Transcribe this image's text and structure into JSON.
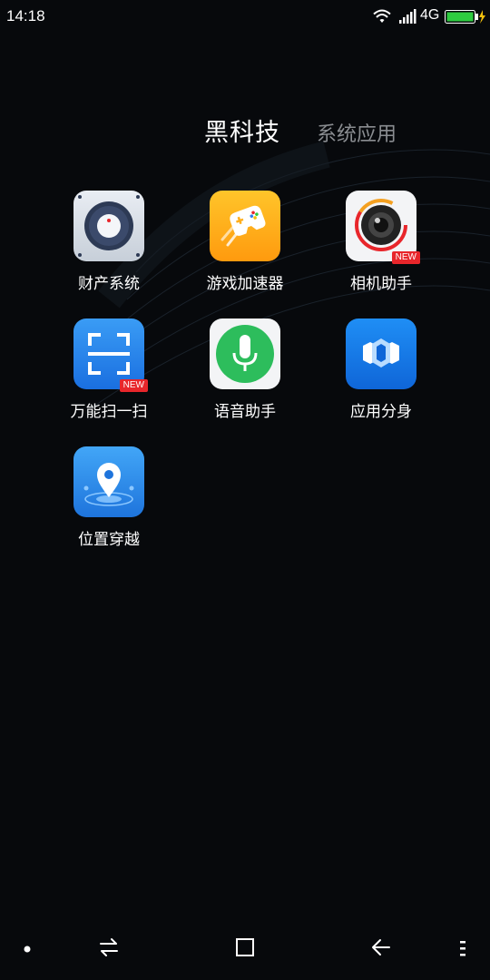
{
  "status_bar": {
    "time": "14:18",
    "network": "4G",
    "icons": [
      "wifi-icon",
      "signal-icon",
      "battery-charging-icon"
    ]
  },
  "tabs": [
    {
      "label": "黑科技",
      "active": true
    },
    {
      "label": "系统应用",
      "active": false
    }
  ],
  "apps": [
    {
      "label": "财产系统",
      "icon": "safe-icon",
      "badge": ""
    },
    {
      "label": "游戏加速器",
      "icon": "gamepad-icon",
      "badge": ""
    },
    {
      "label": "相机助手",
      "icon": "camera-lens-icon",
      "badge": "NEW"
    },
    {
      "label": "万能扫一扫",
      "icon": "scan-icon",
      "badge": "NEW"
    },
    {
      "label": "语音助手",
      "icon": "microphone-icon",
      "badge": ""
    },
    {
      "label": "应用分身",
      "icon": "app-clone-icon",
      "badge": ""
    },
    {
      "label": "位置穿越",
      "icon": "location-pin-icon",
      "badge": ""
    }
  ],
  "nav_bar": [
    "dot-icon",
    "switch-icon",
    "home-square-icon",
    "back-arrow-icon",
    "menu-icon"
  ],
  "colors": {
    "background": "#07090c",
    "tab_inactive": "#8a8d91",
    "badge": "#e8262b",
    "battery": "#2ecc40"
  }
}
